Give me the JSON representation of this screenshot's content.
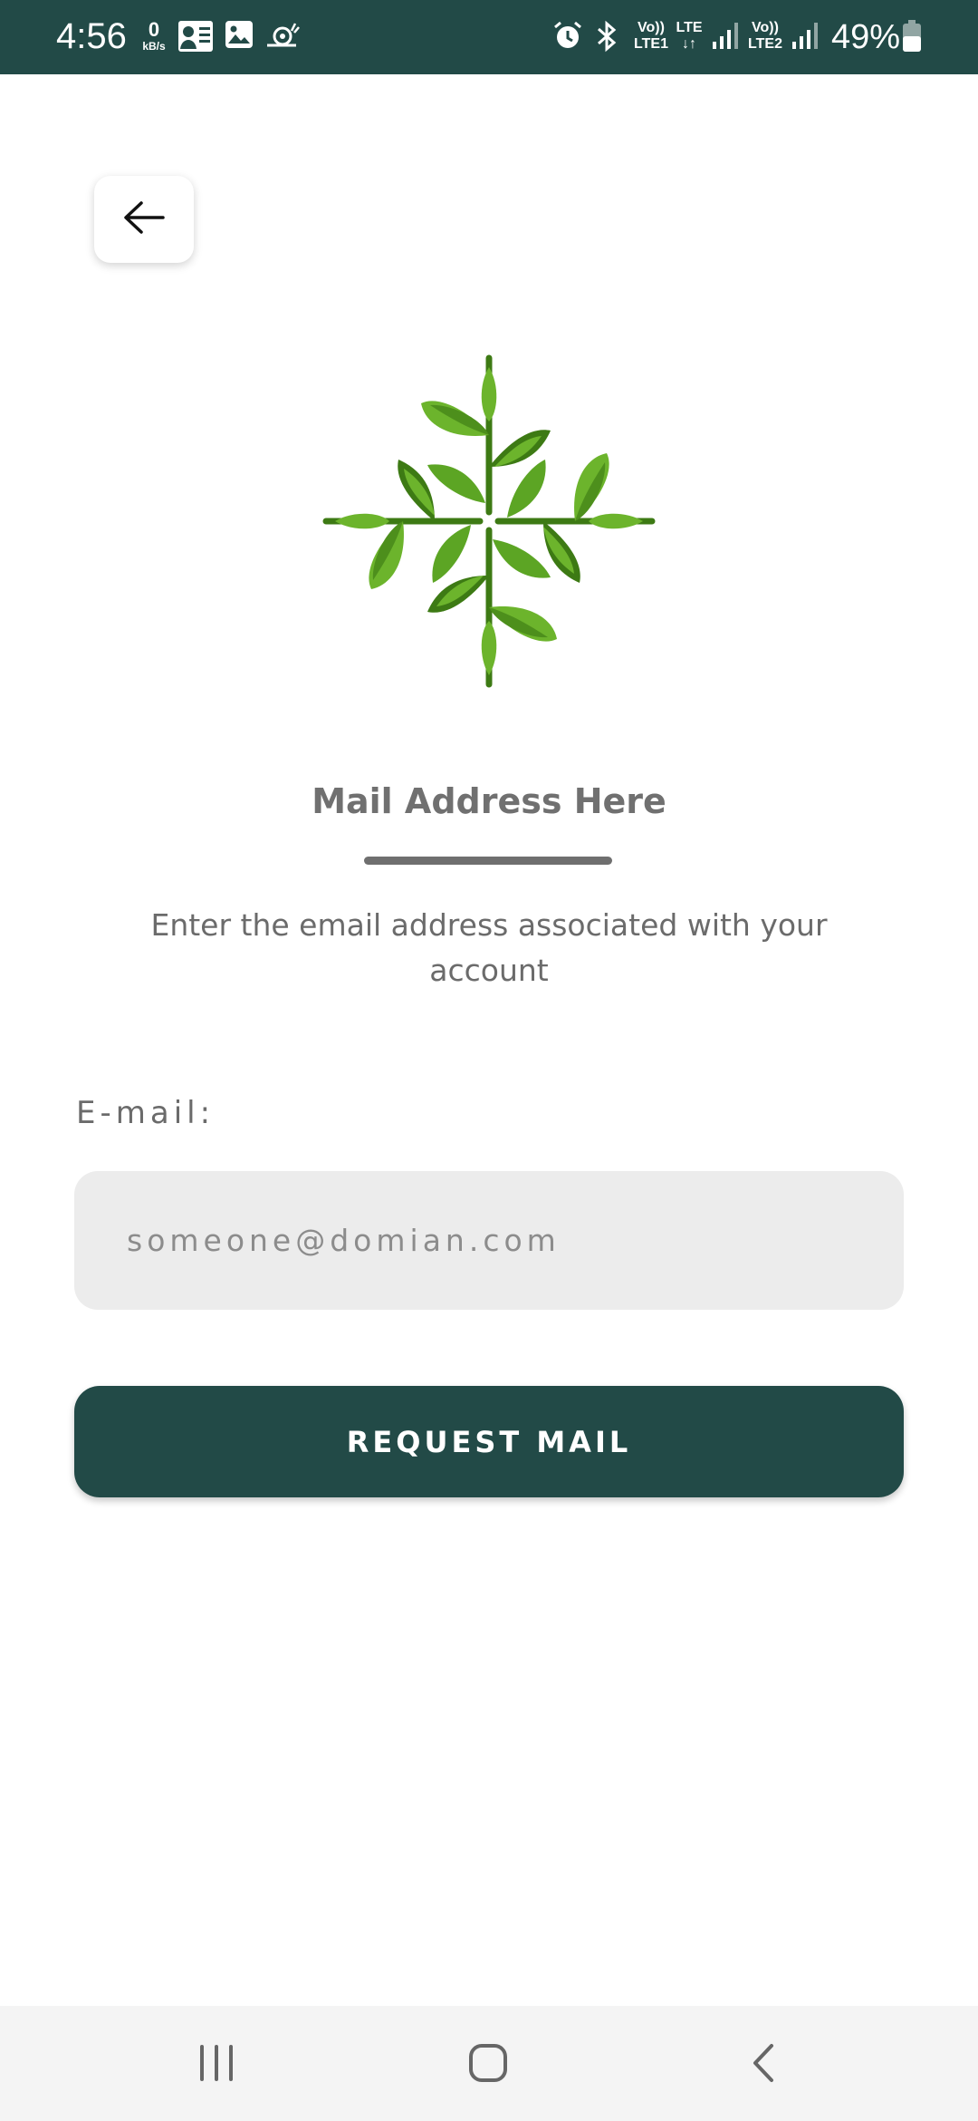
{
  "status_bar": {
    "time": "4:56",
    "net_speed_value": "0",
    "net_speed_unit": "kB/s",
    "sim1_top": "Vo))",
    "sim1_bottom": "LTE1",
    "lte_label": "LTE",
    "sim2_top": "Vo))",
    "sim2_bottom": "LTE2",
    "battery": "49%",
    "icons": [
      "contacts-icon",
      "gallery-icon",
      "snail-icon",
      "alarm-icon",
      "bluetooth-icon",
      "signal-icon",
      "battery-icon"
    ]
  },
  "header": {
    "back_icon": "arrow-left-icon"
  },
  "main": {
    "logo": "leaf-logo-icon",
    "title": "Mail Address Here",
    "subtitle": "Enter the email address associated with your account",
    "email_label": "E-mail:",
    "email_placeholder": "someone@domian.com",
    "email_value": "",
    "request_button_label": "REQUEST MAIL"
  },
  "nav_bar": {
    "icons": [
      "recent-apps-icon",
      "home-icon",
      "back-icon"
    ]
  },
  "colors": {
    "primary": "#224a47",
    "leaf_light": "#6cb42c",
    "leaf_dark": "#3d7a14",
    "input_bg": "#ececec",
    "text_gray": "#6b6b6b"
  }
}
